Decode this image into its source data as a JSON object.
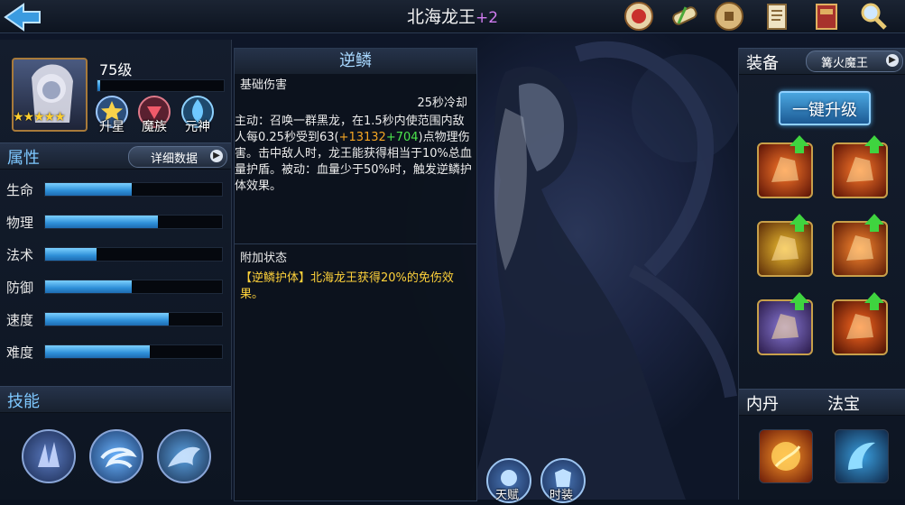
{
  "header": {
    "hero_name": "北海龙王",
    "hero_plus": "+2",
    "icons": [
      "back-arrow-icon",
      "medal-icon",
      "scroll-icon",
      "coin-icon",
      "paper-scroll-icon",
      "book-icon",
      "magnifier-icon"
    ]
  },
  "hero": {
    "level": "75级",
    "stars": "★★★★★",
    "level_progress": 0.02,
    "badges": [
      {
        "label": "升星",
        "icon": "star-badge-icon"
      },
      {
        "label": "魔族",
        "icon": "demon-race-icon"
      },
      {
        "label": "元神",
        "icon": "spirit-flame-icon"
      }
    ]
  },
  "attributes": {
    "title": "属性",
    "detail_button": "详细数据",
    "stats": [
      {
        "label": "生命",
        "value": 0.49
      },
      {
        "label": "物理",
        "value": 0.64
      },
      {
        "label": "法术",
        "value": 0.29
      },
      {
        "label": "防御",
        "value": 0.49
      },
      {
        "label": "速度",
        "value": 0.7
      },
      {
        "label": "难度",
        "value": 0.59
      }
    ]
  },
  "skills": {
    "title": "技能",
    "icons": [
      "crystal-claw-skill-icon",
      "whirlwind-skill-icon",
      "dragon-skill-icon"
    ]
  },
  "skill_detail": {
    "title": "逆鳞",
    "base_damage_label": "基础伤害",
    "cooldown": "25秒冷却",
    "desc_before": "主动：召唤一群黑龙，在1.5秒内使范围内敌人每0.25秒受到63(",
    "desc_orange": "+13132",
    "desc_green": "+704",
    "desc_after": ")点物理伤害。击中敌人时，龙王能获得相当于10%总血量护盾。被动：血量少于50%时，触发逆鳞护体效果。",
    "extra_label": "附加状态",
    "extra_text": "【逆鳞护体】北海龙王获得20%的免伤效果。"
  },
  "equipment": {
    "title": "装备",
    "selector": "篝火魔王",
    "upgrade_all": "一键升级",
    "slots": [
      "fire-gauntlet-icon",
      "fire-gauntlet-icon",
      "golden-helmet-icon",
      "flame-armor-icon",
      "dark-boots-icon",
      "fire-ring-icon"
    ]
  },
  "inner_core": {
    "title": "内丹",
    "icon": "fire-orb-icon"
  },
  "treasure": {
    "title": "法宝",
    "icon": "blue-claw-treasure-icon"
  },
  "bottom_buttons": [
    {
      "label": "天赋",
      "icon": "talent-icon"
    },
    {
      "label": "时装",
      "icon": "costume-icon"
    }
  ],
  "colors": {
    "accent": "#7ec8ff",
    "bar": "#2e8fd8",
    "upgrade_arrow": "#3fd43f",
    "plus": "#d07cf0"
  }
}
